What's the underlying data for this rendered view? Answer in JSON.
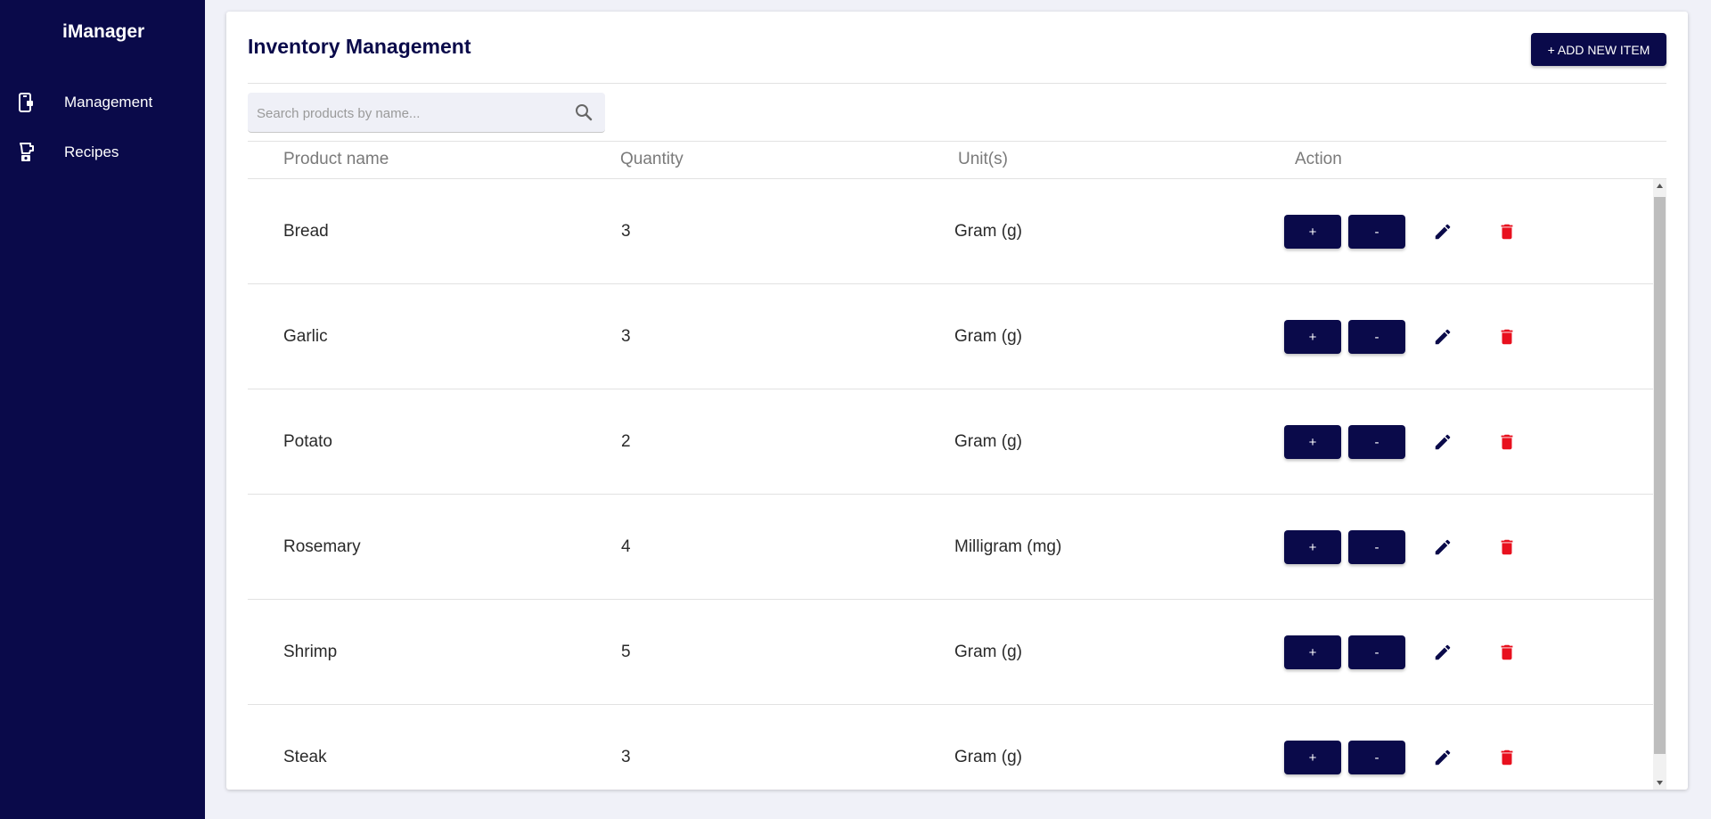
{
  "sidebar": {
    "brand": "iManager",
    "items": [
      {
        "label": "Management",
        "icon": "inventory-icon"
      },
      {
        "label": "Recipes",
        "icon": "blender-icon"
      }
    ]
  },
  "header": {
    "title": "Inventory Management",
    "add_button_label": "+ ADD NEW ITEM"
  },
  "search": {
    "placeholder": "Search products by name...",
    "value": ""
  },
  "table": {
    "columns": [
      "Product name",
      "Quantity",
      "Unit(s)",
      "Action"
    ],
    "rows": [
      {
        "name": "Bread",
        "quantity": "3",
        "unit": "Gram (g)"
      },
      {
        "name": "Garlic",
        "quantity": "3",
        "unit": "Gram (g)"
      },
      {
        "name": "Potato",
        "quantity": "2",
        "unit": "Gram (g)"
      },
      {
        "name": "Rosemary",
        "quantity": "4",
        "unit": "Milligram (mg)"
      },
      {
        "name": "Shrimp",
        "quantity": "5",
        "unit": "Gram (g)"
      },
      {
        "name": "Steak",
        "quantity": "3",
        "unit": "Gram (g)"
      }
    ],
    "increment_label": "+",
    "decrement_label": "-"
  },
  "colors": {
    "primary": "#0a0a4a",
    "delete": "#e8101e",
    "background": "#f0f1f8"
  }
}
